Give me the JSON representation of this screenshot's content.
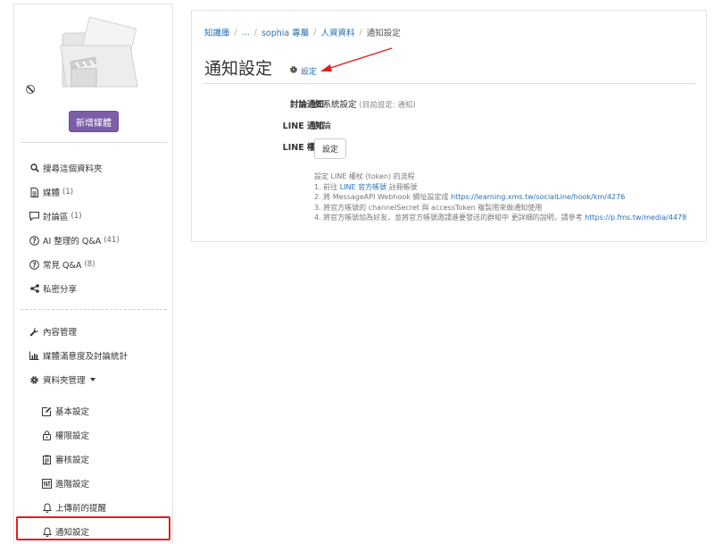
{
  "sidebar": {
    "add_media_label": "新增媒體",
    "items": [
      {
        "label": "搜尋這個資料夾",
        "count": ""
      },
      {
        "label": "媒體",
        "count": "(1)"
      },
      {
        "label": "討論區",
        "count": "(1)"
      },
      {
        "label": "AI 整理的 Q&A",
        "count": "(41)"
      },
      {
        "label": "常見 Q&A",
        "count": "(8)"
      },
      {
        "label": "私密分享",
        "count": ""
      },
      {
        "label": "內容管理",
        "count": ""
      },
      {
        "label": "媒體滿意度及討論統計",
        "count": ""
      },
      {
        "label": "資料夾管理",
        "count": ""
      }
    ],
    "sub_items": [
      {
        "label": "基本設定"
      },
      {
        "label": "權限設定"
      },
      {
        "label": "審核設定"
      },
      {
        "label": "進階設定"
      },
      {
        "label": "上傳前的提醒"
      },
      {
        "label": "通知設定"
      }
    ]
  },
  "breadcrumb": {
    "items": [
      "知識庫",
      "...",
      "sophia 專屬",
      "人資資料",
      "通知設定"
    ]
  },
  "page": {
    "title": "通知設定",
    "settings_link": "設定"
  },
  "fields": {
    "discussion_label": "討論通知",
    "discussion_value": "依系統設定",
    "discussion_hint": "(目前設定: 通知)",
    "line_label": "LINE 通知",
    "line_value": "討論",
    "line_auth_label": "LINE 權杖",
    "line_auth_button": "設定"
  },
  "help": {
    "line0": "設定 LINE 權杖 (token) 的流程",
    "line1_a": "1. 前往",
    "line1_link": "LINE 官方帳號",
    "line1_b": "註冊帳號",
    "line2_a": "2. 將 MessageAPI Webhook 網址設定成",
    "line2_link": "https://learning.xms.tw/socialLine/hook/km/4276",
    "line3": "3. 將官方帳號的 channelSecret 與 accessToken 複製用來做通知使用",
    "line4_a": "4. 將官方帳號加為好友，並將官方帳號邀請進要發送的群組中 更詳細的說明，請參考",
    "line4_link": "https://p.fms.tw/media/4478"
  },
  "colors": {
    "accent_purple": "#7b5ea7",
    "link_blue": "#2a6fb5",
    "highlight_red": "#e02020"
  }
}
